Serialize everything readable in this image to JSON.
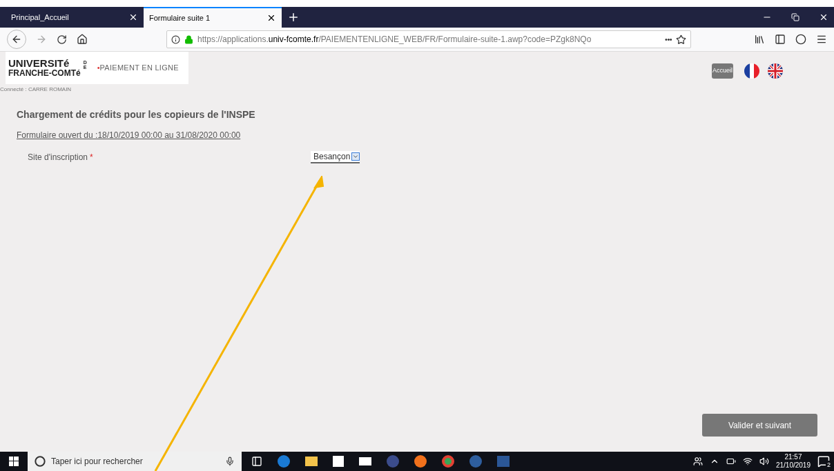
{
  "browser": {
    "tabs": [
      {
        "label": "Principal_Accueil",
        "selected": false
      },
      {
        "label": "Formulaire suite 1",
        "selected": true
      }
    ],
    "url": {
      "prefix": "https://applications.",
      "domain": "univ-fcomte.fr",
      "path": "/PAIEMENTENLIGNE_WEB/FR/Formulaire-suite-1.awp?code=PZgk8NQo"
    },
    "more": "•••"
  },
  "header": {
    "logo": {
      "line1": "UNIVERSITé",
      "de": "DE",
      "line2": "FRANCHE-COMTé"
    },
    "service_bullet": "•",
    "service": "PAIEMENT EN LIGNE",
    "home_button": "Accueil",
    "connected": "Connecté : CARRE ROMAIN"
  },
  "form": {
    "title": "Chargement de crédits pour les copieurs de l'INSPE",
    "period": "Formulaire ouvert du :18/10/2019 00:00 au 31/08/2020 00:00",
    "fields": [
      {
        "label": "Site d'inscription",
        "required_mark": "*",
        "value": "Besançon"
      }
    ],
    "submit": "Valider et suivant"
  },
  "taskbar": {
    "search_placeholder": "Taper ici pour rechercher",
    "time": "21:57",
    "date": "21/10/2019",
    "notifications": "2"
  }
}
